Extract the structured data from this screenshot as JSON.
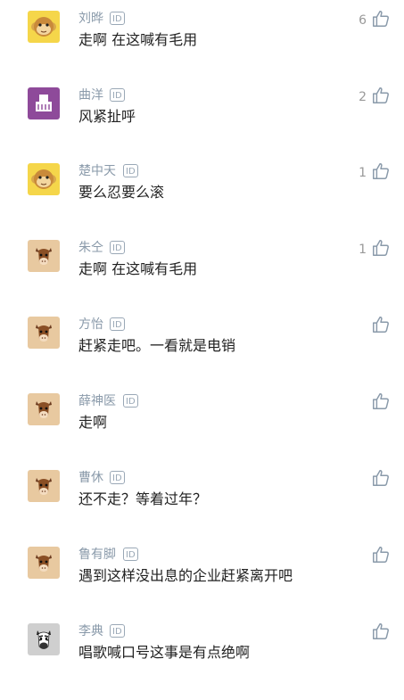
{
  "comments": [
    {
      "username": "刘晔",
      "id_badge": "ID",
      "text": "走啊 在这喊有毛用",
      "likes": "6",
      "avatar": "monkey-yellow-icon"
    },
    {
      "username": "曲洋",
      "id_badge": "ID",
      "text": "风紧扯呼",
      "likes": "2",
      "avatar": "purple-box-icon"
    },
    {
      "username": "楚中天",
      "id_badge": "ID",
      "text": "要么忍要么滚",
      "likes": "1",
      "avatar": "monkey-yellow-icon"
    },
    {
      "username": "朱仝",
      "id_badge": "ID",
      "text": "走啊 在这喊有毛用",
      "likes": "1",
      "avatar": "horse-tan-icon"
    },
    {
      "username": "方怡",
      "id_badge": "ID",
      "text": "赶紧走吧。一看就是电销",
      "likes": "",
      "avatar": "horse-tan-icon"
    },
    {
      "username": "薛神医",
      "id_badge": "ID",
      "text": "走啊",
      "likes": "",
      "avatar": "horse-tan-icon"
    },
    {
      "username": "曹休",
      "id_badge": "ID",
      "text": "还不走？等着过年？",
      "likes": "",
      "avatar": "horse-tan-icon"
    },
    {
      "username": "鲁有脚",
      "id_badge": "ID",
      "text": "遇到这样没出息的企业赶紧离开吧",
      "likes": "",
      "avatar": "horse-tan-icon"
    },
    {
      "username": "李典",
      "id_badge": "ID",
      "text": "唱歌喊口号这事是有点绝啊",
      "likes": "",
      "avatar": "zebra-gray-icon"
    }
  ],
  "colors": {
    "username": "#8a9aaa",
    "text": "#222222",
    "like_icon": "#8a9aaa",
    "avatar_yellow": "#f5d64a",
    "avatar_purple": "#8e4a9a",
    "avatar_tan": "#e8c9a0",
    "avatar_gray": "#cfcfcf"
  }
}
